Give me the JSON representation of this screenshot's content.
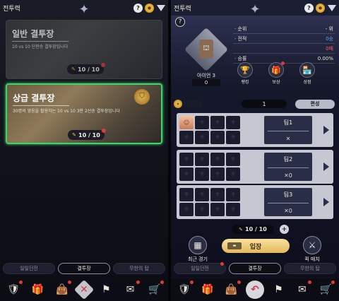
{
  "left": {
    "title": "전투력",
    "card1": {
      "title": "일반 결투장",
      "subtitle": "10 vs 10 단판승 결투장입니다",
      "tickets": "10 / 10"
    },
    "card2": {
      "title": "상급 결투장",
      "subtitle": "30명의 영웅을 활용하는 10 vs 10 3판 2선승 결투장입니다",
      "tickets": "10 / 10"
    },
    "tabs": [
      "일일던전",
      "결투장",
      "무한의 탑"
    ],
    "active_tab": "결투장"
  },
  "right": {
    "title": "전투력",
    "tier": {
      "name": "아이언 3",
      "score": "0"
    },
    "stats": [
      {
        "label": "· 순위",
        "value": "- 위",
        "tone": ""
      },
      {
        "label": "· 전적",
        "value": "0승",
        "tone": "blue"
      },
      {
        "label": "",
        "value": "0패",
        "tone": "red"
      },
      {
        "label": "· 승률",
        "value": "0.00%",
        "tone": ""
      }
    ],
    "buttons": [
      "랭킹",
      "보상",
      "상점"
    ],
    "team_number": "1",
    "edit_label": "편성",
    "teams": [
      {
        "label": "팀1",
        "count": "✕"
      },
      {
        "label": "팀2",
        "count": "✕0"
      },
      {
        "label": "팀3",
        "count": "✕0"
      }
    ],
    "entries": "10 / 10",
    "recent_label": "최근 경기",
    "enter_label": "입장",
    "quick_label": "퀵 매치",
    "tabs": [
      "일일던전",
      "결투장",
      "무한의 탑"
    ],
    "active_tab": "결투장"
  }
}
